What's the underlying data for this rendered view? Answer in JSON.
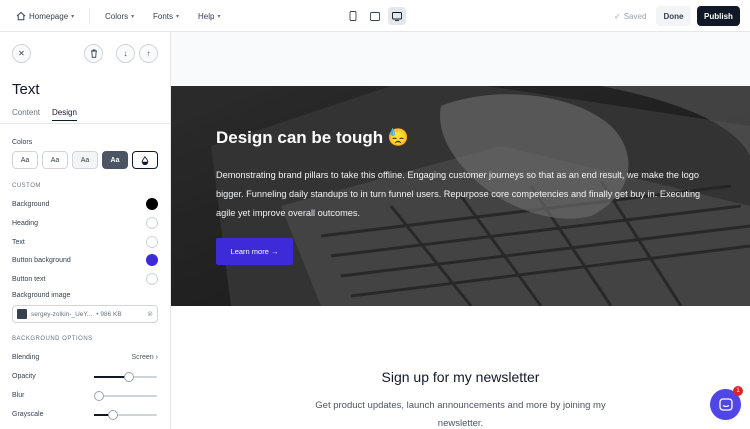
{
  "topbar": {
    "page_menu": "Homepage",
    "colors_menu": "Colors",
    "fonts_menu": "Fonts",
    "help_menu": "Help",
    "saved_status": "Saved",
    "done_label": "Done",
    "publish_label": "Publish"
  },
  "sidebar": {
    "title": "Text",
    "tabs": [
      "Content",
      "Design"
    ],
    "active_tab": "Design",
    "colors_label": "Colors",
    "swatches": [
      "Aa",
      "Aa",
      "Aa",
      "Aa"
    ],
    "custom_caption": "CUSTOM",
    "custom_rows": [
      {
        "label": "Background",
        "color": "#000000"
      },
      {
        "label": "Heading",
        "color": "#ffffff"
      },
      {
        "label": "Text",
        "color": "#ffffff"
      },
      {
        "label": "Button background",
        "color": "#3d2ad9"
      },
      {
        "label": "Button text",
        "color": "#ffffff"
      }
    ],
    "background_image_label": "Background image",
    "file_name": "sergey-zolkin-_UeY...",
    "file_size": "• 986 KB",
    "bg_options_caption": "BACKGROUND OPTIONS",
    "blending_label": "Blending",
    "blending_value": "Screen",
    "opacity_label": "Opacity",
    "opacity_value": 0.55,
    "blur_label": "Blur",
    "blur_value": 0.0,
    "grayscale_label": "Grayscale",
    "grayscale_value": 0.3
  },
  "hero": {
    "title": "Design can be tough 😓",
    "text": "Demonstrating brand pillars to take this offline. Engaging customer journeys so that as an end result, we make the logo bigger. Funneling daily standups to in turn funnel users. Repurpose core competencies and finally get buy in. Executing agile yet improve overall outcomes.",
    "button_label": "Learn more →"
  },
  "newsletter": {
    "title": "Sign up for my newsletter",
    "text": "Get product updates, launch announcements and more by joining my newsletter."
  },
  "chat": {
    "badge": "1"
  },
  "colors": {
    "accent": "#3d2ad9",
    "chat": "#4f46e5",
    "dark": "#111827"
  }
}
